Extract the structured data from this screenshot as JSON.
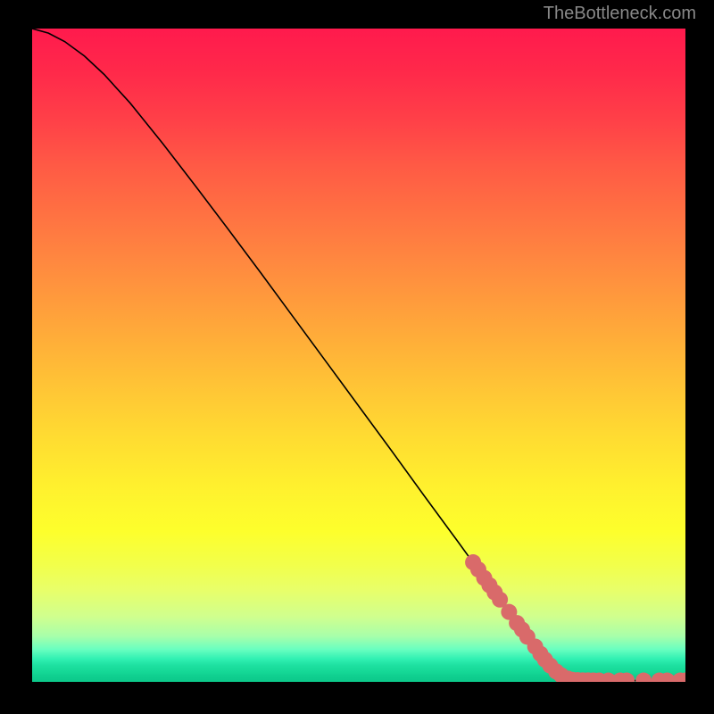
{
  "attribution": "TheBottleneck.com",
  "chart_data": {
    "type": "line",
    "title": "",
    "xlabel": "",
    "ylabel": "",
    "xlim": [
      0,
      100
    ],
    "ylim": [
      0,
      100
    ],
    "gradient": {
      "from": "#ff1a4d",
      "to": "#0cc88a",
      "description": "vertical red→orange→yellow→green gradient background"
    },
    "series": [
      {
        "name": "bottleneck-curve",
        "color": "#000000",
        "points": [
          {
            "x": 0.0,
            "y": 100.0
          },
          {
            "x": 2.5,
            "y": 99.3
          },
          {
            "x": 5.0,
            "y": 98.0
          },
          {
            "x": 8.0,
            "y": 95.8
          },
          {
            "x": 11.0,
            "y": 93.0
          },
          {
            "x": 15.0,
            "y": 88.6
          },
          {
            "x": 20.0,
            "y": 82.4
          },
          {
            "x": 25.0,
            "y": 75.9
          },
          {
            "x": 30.0,
            "y": 69.3
          },
          {
            "x": 35.0,
            "y": 62.6
          },
          {
            "x": 40.0,
            "y": 55.8
          },
          {
            "x": 45.0,
            "y": 49.0
          },
          {
            "x": 50.0,
            "y": 42.2
          },
          {
            "x": 55.0,
            "y": 35.4
          },
          {
            "x": 60.0,
            "y": 28.5
          },
          {
            "x": 65.0,
            "y": 21.7
          },
          {
            "x": 70.0,
            "y": 14.8
          },
          {
            "x": 74.0,
            "y": 9.3
          },
          {
            "x": 78.0,
            "y": 4.0
          },
          {
            "x": 81.0,
            "y": 1.0
          },
          {
            "x": 83.0,
            "y": 0.3
          },
          {
            "x": 86.0,
            "y": 0.2
          },
          {
            "x": 90.0,
            "y": 0.2
          },
          {
            "x": 95.0,
            "y": 0.2
          },
          {
            "x": 100.0,
            "y": 0.2
          }
        ]
      },
      {
        "name": "highlighted-points",
        "color": "#d96a6a",
        "type": "scatter",
        "points": [
          {
            "x": 67.5,
            "y": 18.3
          },
          {
            "x": 68.3,
            "y": 17.2
          },
          {
            "x": 69.2,
            "y": 15.9
          },
          {
            "x": 70.0,
            "y": 14.8
          },
          {
            "x": 70.8,
            "y": 13.7
          },
          {
            "x": 71.6,
            "y": 12.6
          },
          {
            "x": 73.0,
            "y": 10.7
          },
          {
            "x": 74.2,
            "y": 9.0
          },
          {
            "x": 75.0,
            "y": 8.0
          },
          {
            "x": 75.8,
            "y": 6.9
          },
          {
            "x": 77.0,
            "y": 5.4
          },
          {
            "x": 77.8,
            "y": 4.3
          },
          {
            "x": 78.5,
            "y": 3.4
          },
          {
            "x": 79.3,
            "y": 2.5
          },
          {
            "x": 80.2,
            "y": 1.6
          },
          {
            "x": 81.0,
            "y": 1.0
          },
          {
            "x": 82.0,
            "y": 0.5
          },
          {
            "x": 82.7,
            "y": 0.3
          },
          {
            "x": 83.5,
            "y": 0.25
          },
          {
            "x": 84.3,
            "y": 0.23
          },
          {
            "x": 85.1,
            "y": 0.22
          },
          {
            "x": 85.9,
            "y": 0.21
          },
          {
            "x": 86.8,
            "y": 0.2
          },
          {
            "x": 88.2,
            "y": 0.2
          },
          {
            "x": 90.0,
            "y": 0.2
          },
          {
            "x": 91.0,
            "y": 0.2
          },
          {
            "x": 93.6,
            "y": 0.2
          },
          {
            "x": 96.0,
            "y": 0.2
          },
          {
            "x": 97.2,
            "y": 0.2
          },
          {
            "x": 99.2,
            "y": 0.2
          },
          {
            "x": 100.0,
            "y": 0.2
          }
        ]
      }
    ]
  }
}
